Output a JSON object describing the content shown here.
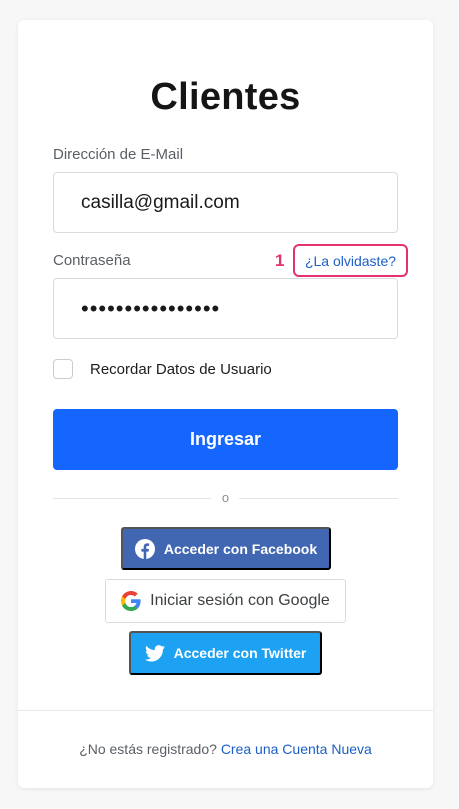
{
  "title": "Clientes",
  "email": {
    "label": "Dirección de E-Mail",
    "value": "casilla@gmail.com"
  },
  "password": {
    "label": "Contraseña",
    "value": "••••••••••••••••",
    "forgot_link": "¿La olvidaste?",
    "annotation_number": "1"
  },
  "remember": {
    "label": "Recordar Datos de Usuario",
    "checked": false
  },
  "login_button": "Ingresar",
  "divider_text": "o",
  "social": {
    "facebook": "Acceder con Facebook",
    "google": "Iniciar sesión con Google",
    "twitter": "Acceder con Twitter"
  },
  "footer": {
    "prompt": "¿No estás registrado?",
    "link": "Crea una Cuenta Nueva"
  },
  "colors": {
    "primary": "#1565ff",
    "link": "#1c5fc7",
    "highlight": "#e4316f",
    "facebook": "#4267b2",
    "twitter": "#1da1f2"
  },
  "icons": {
    "facebook": "facebook-icon",
    "google": "google-icon",
    "twitter": "twitter-icon"
  }
}
